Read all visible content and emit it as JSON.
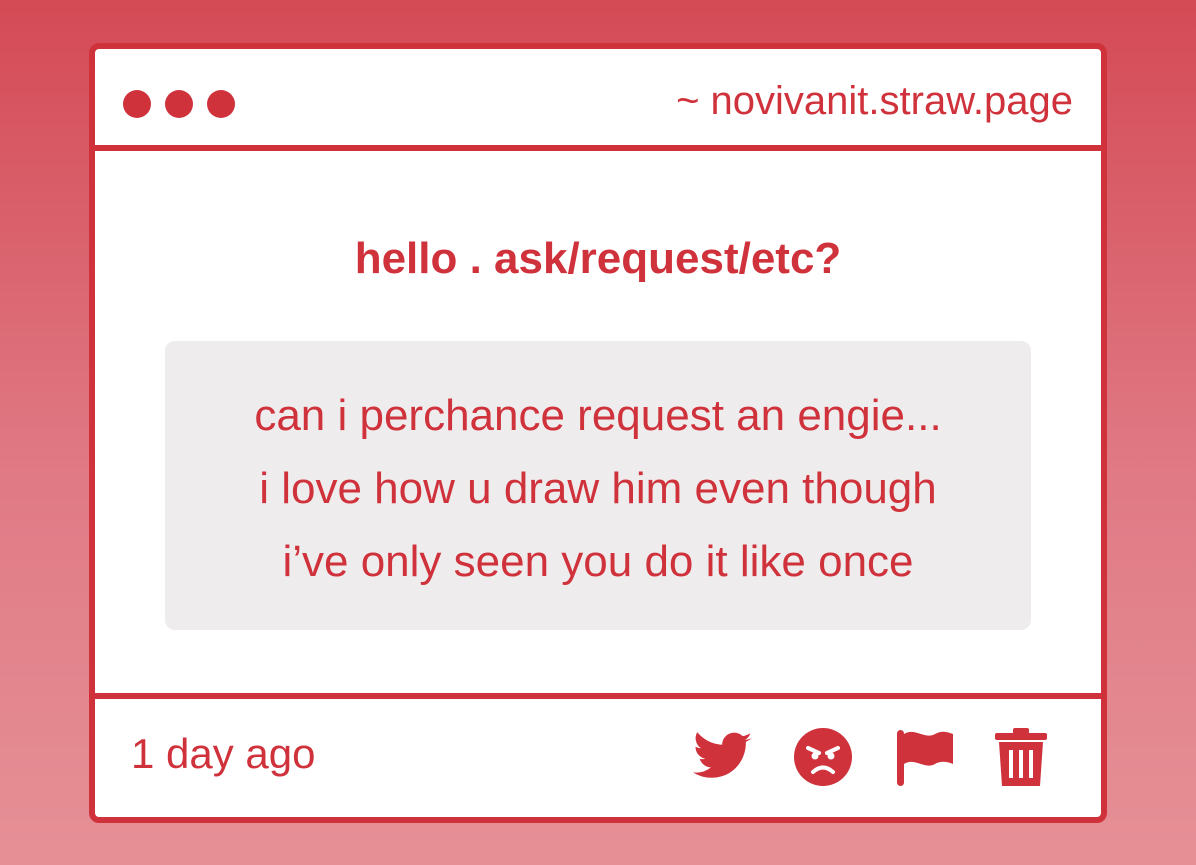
{
  "header": {
    "url": "~ novivanit.straw.page"
  },
  "content": {
    "prompt": "hello . ask/request/etc?",
    "message_lines": [
      "can i perchance request an engie...",
      "i love how u draw him even though",
      "i’ve only seen you do it like once"
    ]
  },
  "footer": {
    "timestamp": "1 day ago",
    "actions": [
      {
        "name": "twitter-icon"
      },
      {
        "name": "angry-face-icon"
      },
      {
        "name": "flag-icon"
      },
      {
        "name": "trash-icon"
      }
    ]
  },
  "colors": {
    "accent": "#d0323c",
    "message_background": "#eeeced",
    "window_background": "#ffffff"
  }
}
